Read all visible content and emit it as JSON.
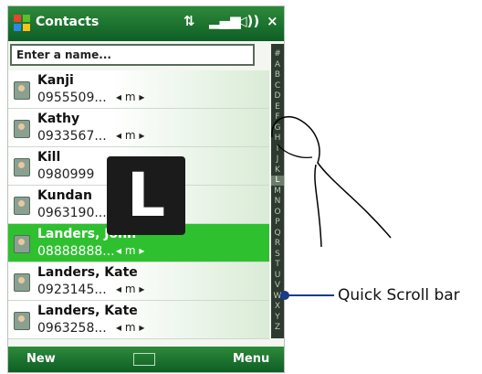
{
  "titlebar": {
    "title": "Contacts",
    "close": "×"
  },
  "status_icons": [
    "connectivity-icon",
    "signal-icon",
    "volume-icon"
  ],
  "search": {
    "placeholder": "Enter a name..."
  },
  "contacts": [
    {
      "name": "Kanji",
      "number": "0955509...",
      "mode": "◂ m ▸",
      "selected": false
    },
    {
      "name": "Kathy",
      "number": "0933567...",
      "mode": "◂ m ▸",
      "selected": false
    },
    {
      "name": "Kill",
      "number": "0980999",
      "mode": "",
      "selected": false
    },
    {
      "name": "Kundan",
      "number": "0963190...",
      "mode": "",
      "selected": false
    },
    {
      "name": "Landers, John",
      "number": "08888888...",
      "mode": "◂ m ▸",
      "selected": true
    },
    {
      "name": "Landers, Kate",
      "number": "0923145...",
      "mode": "◂ m ▸",
      "selected": false
    },
    {
      "name": "Landers, Kate",
      "number": "0963258...",
      "mode": "◂ m ▸",
      "selected": false
    }
  ],
  "quick_scroll": {
    "letters": [
      "#",
      "A",
      "B",
      "C",
      "D",
      "E",
      "F",
      "G",
      "H",
      "I",
      "J",
      "K",
      "L",
      "M",
      "N",
      "O",
      "P",
      "Q",
      "R",
      "S",
      "T",
      "U",
      "V",
      "W",
      "X",
      "Y",
      "Z"
    ],
    "active": "L"
  },
  "bubble_letter": "L",
  "menubar": {
    "left": "New",
    "right": "Menu"
  },
  "callout": "Quick Scroll bar"
}
